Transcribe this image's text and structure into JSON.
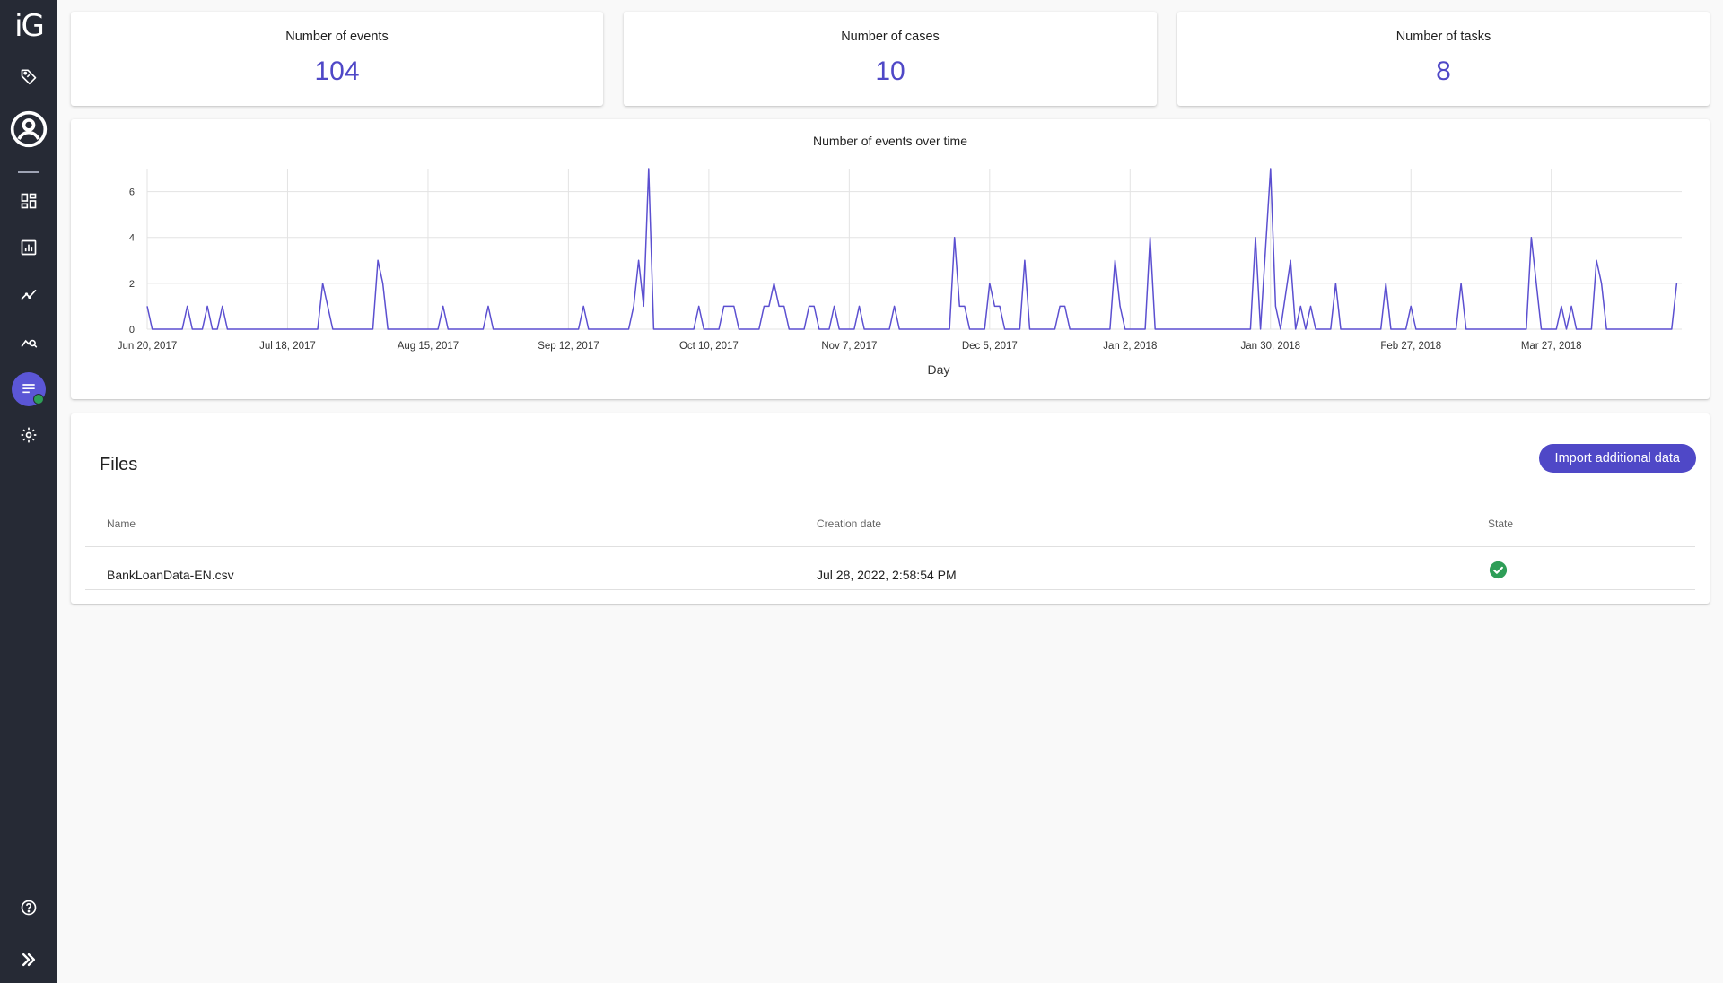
{
  "app": {
    "logo": "iG"
  },
  "sidebar": {
    "items": [
      {
        "icon": "tag-icon"
      },
      {
        "icon": "user-circle-icon"
      },
      {
        "icon": "dashboard-icon"
      },
      {
        "icon": "report-icon"
      },
      {
        "icon": "trend-icon"
      },
      {
        "icon": "analysis-icon"
      },
      {
        "icon": "data-check-icon",
        "active": true
      },
      {
        "icon": "gear-icon"
      },
      {
        "icon": "help-icon"
      },
      {
        "icon": "expand-icon"
      }
    ],
    "active_color": "#5b56d6"
  },
  "stats": [
    {
      "label": "Number of events",
      "value": "104"
    },
    {
      "label": "Number of cases",
      "value": "10"
    },
    {
      "label": "Number of tasks",
      "value": "8"
    }
  ],
  "chart_data": {
    "type": "line",
    "title": "Number of events over time",
    "xlabel": "Day",
    "ylabel": "",
    "color": "#5b4fd0",
    "ylim": [
      0,
      7
    ],
    "yticks": [
      0,
      2,
      4,
      6
    ],
    "xlim": [
      "2017-06-20",
      "2018-04-22"
    ],
    "xticks": [
      {
        "date": "2017-06-20",
        "label": "Jun 20, 2017"
      },
      {
        "date": "2017-07-18",
        "label": "Jul 18, 2017"
      },
      {
        "date": "2017-08-15",
        "label": "Aug 15, 2017"
      },
      {
        "date": "2017-09-12",
        "label": "Sep 12, 2017"
      },
      {
        "date": "2017-10-10",
        "label": "Oct 10, 2017"
      },
      {
        "date": "2017-11-07",
        "label": "Nov 7, 2017"
      },
      {
        "date": "2017-12-05",
        "label": "Dec 5, 2017"
      },
      {
        "date": "2018-01-02",
        "label": "Jan 2, 2018"
      },
      {
        "date": "2018-01-30",
        "label": "Jan 30, 2018"
      },
      {
        "date": "2018-02-27",
        "label": "Feb 27, 2018"
      },
      {
        "date": "2018-03-27",
        "label": "Mar 27, 2018"
      }
    ],
    "points": [
      [
        "2017-06-20",
        1
      ],
      [
        "2017-06-21",
        0
      ],
      [
        "2017-06-27",
        0
      ],
      [
        "2017-06-28",
        1
      ],
      [
        "2017-06-29",
        0
      ],
      [
        "2017-07-01",
        0
      ],
      [
        "2017-07-02",
        1
      ],
      [
        "2017-07-03",
        0
      ],
      [
        "2017-07-04",
        0
      ],
      [
        "2017-07-05",
        1
      ],
      [
        "2017-07-06",
        0
      ],
      [
        "2017-07-24",
        0
      ],
      [
        "2017-07-25",
        2
      ],
      [
        "2017-07-27",
        0
      ],
      [
        "2017-08-04",
        0
      ],
      [
        "2017-08-05",
        3
      ],
      [
        "2017-08-06",
        2
      ],
      [
        "2017-08-07",
        0
      ],
      [
        "2017-08-17",
        0
      ],
      [
        "2017-08-18",
        1
      ],
      [
        "2017-08-19",
        0
      ],
      [
        "2017-08-26",
        0
      ],
      [
        "2017-08-27",
        1
      ],
      [
        "2017-08-28",
        0
      ],
      [
        "2017-09-14",
        0
      ],
      [
        "2017-09-15",
        1
      ],
      [
        "2017-09-16",
        0
      ],
      [
        "2017-09-24",
        0
      ],
      [
        "2017-09-25",
        1
      ],
      [
        "2017-09-26",
        3
      ],
      [
        "2017-09-27",
        1
      ],
      [
        "2017-09-28",
        7
      ],
      [
        "2017-09-29",
        0
      ],
      [
        "2017-10-07",
        0
      ],
      [
        "2017-10-08",
        1
      ],
      [
        "2017-10-09",
        0
      ],
      [
        "2017-10-12",
        0
      ],
      [
        "2017-10-13",
        1
      ],
      [
        "2017-10-15",
        1
      ],
      [
        "2017-10-16",
        0
      ],
      [
        "2017-10-20",
        0
      ],
      [
        "2017-10-21",
        1
      ],
      [
        "2017-10-22",
        1
      ],
      [
        "2017-10-23",
        2
      ],
      [
        "2017-10-24",
        1
      ],
      [
        "2017-10-25",
        1
      ],
      [
        "2017-10-26",
        0
      ],
      [
        "2017-10-29",
        0
      ],
      [
        "2017-10-30",
        1
      ],
      [
        "2017-10-31",
        1
      ],
      [
        "2017-11-01",
        0
      ],
      [
        "2017-11-03",
        0
      ],
      [
        "2017-11-04",
        1
      ],
      [
        "2017-11-05",
        0
      ],
      [
        "2017-11-08",
        0
      ],
      [
        "2017-11-09",
        1
      ],
      [
        "2017-11-10",
        0
      ],
      [
        "2017-11-15",
        0
      ],
      [
        "2017-11-16",
        1
      ],
      [
        "2017-11-17",
        0
      ],
      [
        "2017-11-27",
        0
      ],
      [
        "2017-11-28",
        4
      ],
      [
        "2017-11-29",
        1
      ],
      [
        "2017-11-30",
        1
      ],
      [
        "2017-12-01",
        0
      ],
      [
        "2017-12-04",
        0
      ],
      [
        "2017-12-05",
        2
      ],
      [
        "2017-12-06",
        1
      ],
      [
        "2017-12-07",
        1
      ],
      [
        "2017-12-08",
        0
      ],
      [
        "2017-12-11",
        0
      ],
      [
        "2017-12-12",
        3
      ],
      [
        "2017-12-13",
        0
      ],
      [
        "2017-12-18",
        0
      ],
      [
        "2017-12-19",
        1
      ],
      [
        "2017-12-20",
        1
      ],
      [
        "2017-12-21",
        0
      ],
      [
        "2017-12-29",
        0
      ],
      [
        "2017-12-30",
        3
      ],
      [
        "2017-12-31",
        1
      ],
      [
        "2018-01-01",
        0
      ],
      [
        "2018-01-05",
        0
      ],
      [
        "2018-01-06",
        4
      ],
      [
        "2018-01-07",
        0
      ],
      [
        "2018-01-26",
        0
      ],
      [
        "2018-01-27",
        4
      ],
      [
        "2018-01-28",
        0
      ],
      [
        "2018-01-30",
        7
      ],
      [
        "2018-01-31",
        1
      ],
      [
        "2018-02-01",
        0
      ],
      [
        "2018-02-03",
        3
      ],
      [
        "2018-02-04",
        0
      ],
      [
        "2018-02-05",
        1
      ],
      [
        "2018-02-06",
        0
      ],
      [
        "2018-02-07",
        1
      ],
      [
        "2018-02-08",
        0
      ],
      [
        "2018-02-11",
        0
      ],
      [
        "2018-02-12",
        2
      ],
      [
        "2018-02-13",
        0
      ],
      [
        "2018-02-21",
        0
      ],
      [
        "2018-02-22",
        2
      ],
      [
        "2018-02-23",
        0
      ],
      [
        "2018-02-26",
        0
      ],
      [
        "2018-02-27",
        1
      ],
      [
        "2018-02-28",
        0
      ],
      [
        "2018-03-08",
        0
      ],
      [
        "2018-03-09",
        2
      ],
      [
        "2018-03-10",
        0
      ],
      [
        "2018-03-22",
        0
      ],
      [
        "2018-03-23",
        4
      ],
      [
        "2018-03-25",
        0
      ],
      [
        "2018-03-28",
        0
      ],
      [
        "2018-03-29",
        1
      ],
      [
        "2018-03-30",
        0
      ],
      [
        "2018-03-31",
        1
      ],
      [
        "2018-04-01",
        0
      ],
      [
        "2018-04-04",
        0
      ],
      [
        "2018-04-05",
        3
      ],
      [
        "2018-04-06",
        2
      ],
      [
        "2018-04-07",
        0
      ],
      [
        "2018-04-20",
        0
      ],
      [
        "2018-04-21",
        2
      ]
    ]
  },
  "files": {
    "title": "Files",
    "import_button": "Import additional data",
    "columns": [
      "Name",
      "Creation date",
      "State"
    ],
    "rows": [
      {
        "name": "BankLoanData-EN.csv",
        "created": "Jul 28, 2022, 2:58:54 PM",
        "state": "success"
      }
    ],
    "state_color": "#2e9e57"
  }
}
